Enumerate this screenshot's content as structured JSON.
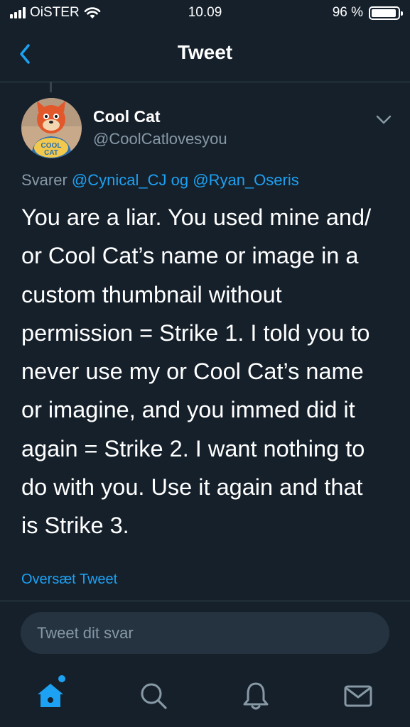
{
  "status_bar": {
    "carrier": "OiSTER",
    "time": "10.09",
    "battery_percent": "96 %",
    "battery_level": 0.96
  },
  "nav": {
    "title": "Tweet"
  },
  "author": {
    "name": "Cool Cat",
    "handle": "@CoolCatlovesyou",
    "avatar_text": "COOL CAT"
  },
  "reply_context": {
    "prefix": "Svarer",
    "user1": "@Cynical_CJ",
    "conjunction": "og",
    "user2": "@Ryan_Oseris"
  },
  "tweet": {
    "text": "You are a liar. You used mine and/\nor Cool Cat’s name or image in a\ncustom thumbnail without\npermission = Strike 1.  I told you to\nnever use my or Cool Cat’s name\nor imagine, and you immed did it\nagain = Strike 2. I want nothing to\ndo with you. Use it again and that\nis Strike 3."
  },
  "translate_label": "Oversæt Tweet",
  "reply_input": {
    "placeholder": "Tweet dit svar"
  },
  "colors": {
    "background": "#15202b",
    "accent": "#1da1f2",
    "secondary_text": "#8899a6",
    "divider": "#38444d"
  },
  "tabs": [
    "home-icon",
    "search-icon",
    "notifications-icon",
    "messages-icon"
  ]
}
